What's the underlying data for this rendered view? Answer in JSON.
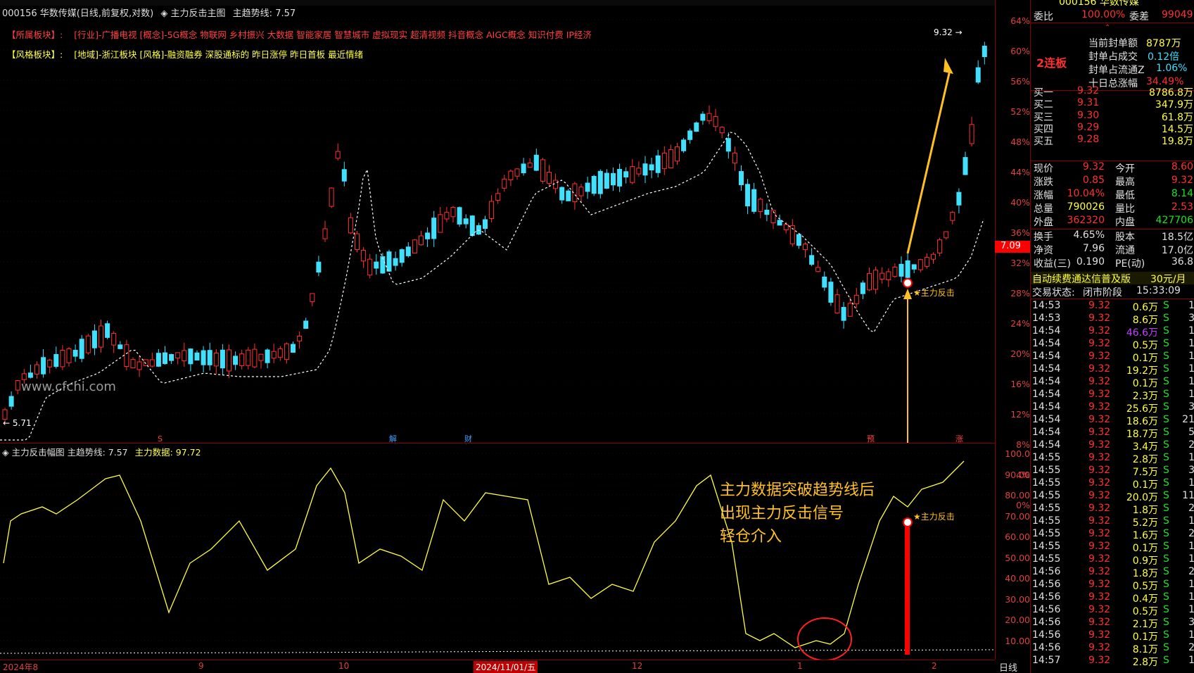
{
  "header": {
    "code": "000156",
    "name": "华数传媒",
    "mode": "(日线,前复权,对数)",
    "indicator": "主力反击主图",
    "trend_label": "主趋势线:",
    "trend_value": "7.57"
  },
  "sectors": {
    "industry_label": "【所属板块】:",
    "industry_items": "[行业]-广播电视 [概念]-5G概念 物联网 乡村振兴 大数据 智能家居 智慧城市 虚拟现实 超清视频 抖音概念 AIGC概念 知识付费 IP经济",
    "style_label": "【风格板块】:",
    "style_items": "[地域]-浙江板块 [风格]-融资融券 深股通标的 昨日涨停 昨日首板 最近情绪"
  },
  "watermark": "www.cfchi.com",
  "main_chart": {
    "high_label": "9.32",
    "low_label": "5.71",
    "signal_label": "★主力反击",
    "price_flag": "7.09",
    "event_markers": [
      "S",
      "解",
      "财",
      "预",
      "涨"
    ],
    "y_ticks": [
      "64%",
      "60%",
      "56%",
      "52%",
      "48%",
      "44%",
      "40%",
      "36%",
      "32%",
      "28%",
      "24%",
      "20%",
      "16%",
      "12%",
      "8%",
      "4%",
      "0%"
    ]
  },
  "sub_chart": {
    "title": "主力反击幅图",
    "trend_label": "主趋势线: 7.57",
    "data_label": "主力数据: 97.72",
    "signal_label": "★主力反击",
    "y_ticks": [
      "100.0",
      "90.00",
      "80.00",
      "70.00",
      "60.00",
      "50.00",
      "40.00",
      "30.00",
      "20.00",
      "10.00"
    ]
  },
  "annotation": {
    "line1": "主力数据突破趋势线后",
    "line2": "出现主力反击信号",
    "line3": "轻仓介入"
  },
  "dates": {
    "d0": "2024年8",
    "d1": "9",
    "d2": "10",
    "d3": "2024/11/01/五",
    "d4": "12",
    "d5": "1",
    "d6": "2",
    "tab": "日线"
  },
  "panel": {
    "top_title": "000156 华数传媒",
    "weibi_label": "委比",
    "weibi_value": "100.00%",
    "weicha_label": "委差",
    "weicha_value": "99049",
    "board_label": "2连板",
    "seal_amount_label": "当前封单额",
    "seal_amount": "8787万",
    "seal_ratio_label": "封单占成交",
    "seal_ratio": "0.12倍",
    "seal_float_label": "封单占流通Z",
    "seal_float": "1.06%",
    "ten_day_label": "十日总涨幅",
    "ten_day": "34.49%",
    "bids": [
      {
        "label": "买一",
        "price": "9.32",
        "vol": "8786.8万"
      },
      {
        "label": "买二",
        "price": "9.31",
        "vol": "347.9万"
      },
      {
        "label": "买三",
        "price": "9.30",
        "vol": "61.8万"
      },
      {
        "label": "买四",
        "price": "9.29",
        "vol": "14.5万"
      },
      {
        "label": "买五",
        "price": "9.28",
        "vol": "19.8万"
      }
    ],
    "quote": [
      {
        "l1": "现价",
        "v1": "9.32",
        "l2": "今开",
        "v2": "8.60"
      },
      {
        "l1": "涨跌",
        "v1": "0.85",
        "l2": "最高",
        "v2": "9.32"
      },
      {
        "l1": "涨幅",
        "v1": "10.04%",
        "l2": "最低",
        "v2": "8.14"
      },
      {
        "l1": "总量",
        "v1": "790026",
        "l2": "量比",
        "v2": "2.53"
      },
      {
        "l1": "外盘",
        "v1": "362320",
        "l2": "内盘",
        "v2": "427706"
      }
    ],
    "fund": [
      {
        "l1": "换手",
        "v1": "4.65%",
        "l2": "股本",
        "v2": "18.5亿"
      },
      {
        "l1": "净资",
        "v1": "7.96",
        "l2": "流通",
        "v2": "17.0亿"
      },
      {
        "l1": "收益(三)",
        "v1": "0.190",
        "l2": "PE(动)",
        "v2": "36.8"
      }
    ],
    "promo": "自动续费通达信普及版",
    "promo_price": "30元/月",
    "status_label": "交易状态:",
    "status_value": "闭市阶段",
    "status_time": "15:33:09",
    "ticks": [
      [
        "14:53",
        "9.32",
        "0.6万",
        "S",
        "1"
      ],
      [
        "14:53",
        "9.32",
        "8.6万",
        "S",
        "3"
      ],
      [
        "14:54",
        "9.32",
        "46.6万",
        "S",
        "1"
      ],
      [
        "14:54",
        "9.32",
        "0.5万",
        "S",
        "1"
      ],
      [
        "14:54",
        "9.32",
        "0.1万",
        "S",
        "1"
      ],
      [
        "14:54",
        "9.32",
        "19.2万",
        "S",
        "1"
      ],
      [
        "14:54",
        "9.32",
        "0.1万",
        "S",
        "1"
      ],
      [
        "14:54",
        "9.32",
        "2.3万",
        "S",
        "1"
      ],
      [
        "14:54",
        "9.32",
        "25.6万",
        "S",
        "3"
      ],
      [
        "14:54",
        "9.32",
        "18.6万",
        "S",
        "21"
      ],
      [
        "14:54",
        "9.32",
        "18.7万",
        "S",
        "5"
      ],
      [
        "14:54",
        "9.32",
        "3.4万",
        "S",
        "2"
      ],
      [
        "14:55",
        "9.32",
        "2.8万",
        "S",
        "1"
      ],
      [
        "14:55",
        "9.32",
        "7.5万",
        "S",
        "3"
      ],
      [
        "14:55",
        "9.32",
        "0.1万",
        "S",
        "1"
      ],
      [
        "14:55",
        "9.32",
        "20.0万",
        "S",
        "11"
      ],
      [
        "14:55",
        "9.32",
        "1.8万",
        "S",
        "2"
      ],
      [
        "14:55",
        "9.32",
        "5.2万",
        "S",
        "1"
      ],
      [
        "14:55",
        "9.32",
        "1.6万",
        "S",
        "2"
      ],
      [
        "14:55",
        "9.32",
        "0.1万",
        "S",
        "1"
      ],
      [
        "14:55",
        "9.32",
        "0.9万",
        "S",
        "1"
      ],
      [
        "14:56",
        "9.32",
        "1.8万",
        "S",
        "2"
      ],
      [
        "14:56",
        "9.32",
        "0.5万",
        "S",
        "1"
      ],
      [
        "14:56",
        "9.32",
        "0.4万",
        "S",
        "1"
      ],
      [
        "14:56",
        "9.32",
        "0.5万",
        "S",
        "1"
      ],
      [
        "14:56",
        "9.32",
        "2.1万",
        "S",
        "3"
      ],
      [
        "14:56",
        "9.32",
        "0.1万",
        "S",
        "1"
      ],
      [
        "14:56",
        "9.32",
        "8.1万",
        "S",
        "2"
      ],
      [
        "14:57",
        "9.32",
        "2.8万",
        "S",
        "1"
      ]
    ]
  },
  "colors": {
    "up": "#ff3030",
    "down": "#40e0ff",
    "signal": "#ffc020",
    "line": "#ffff40"
  }
}
